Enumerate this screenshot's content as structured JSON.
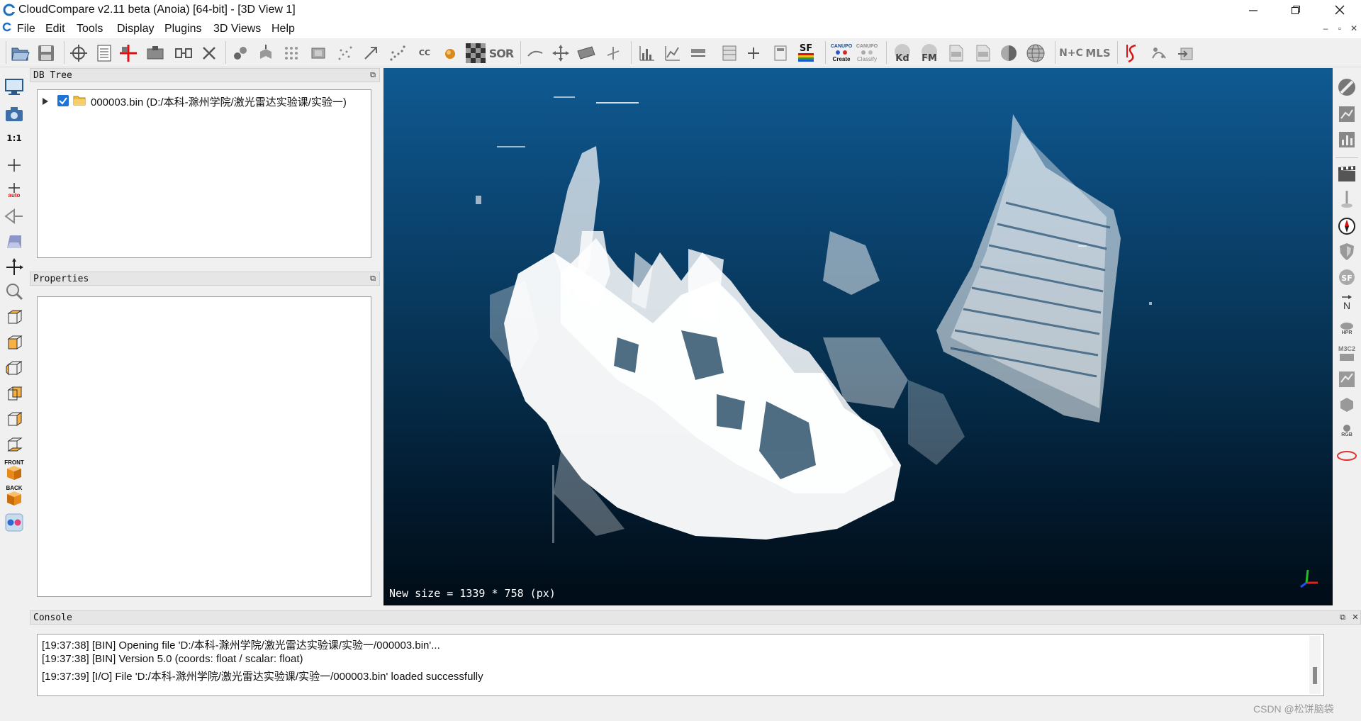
{
  "window": {
    "title": "CloudCompare v2.11 beta (Anoia) [64-bit] - [3D View 1]",
    "minimize_icon": "minimize-icon",
    "restore_icon": "restore-icon",
    "close_icon": "close-icon"
  },
  "menu": {
    "items": [
      "File",
      "Edit",
      "Tools",
      "Display",
      "Plugins",
      "3D Views",
      "Help"
    ]
  },
  "toolbar": {
    "sor_label": "SOR",
    "sf_label": "SF",
    "canupo_create_top": "CANUPO",
    "canupo_create_bottom": "Create",
    "canupo_classify_top": "CANUPO",
    "canupo_classify_bottom": "Classify",
    "kd_label": "Kd",
    "fm_label": "FM",
    "nc_label": "N+C",
    "mls_label": "MLS",
    "cc_label": "CC"
  },
  "left_toolbar": {
    "one_to_one_label": "1:1",
    "auto_label": "auto",
    "front_label": "FRONT",
    "back_label": "BACK"
  },
  "right_toolbar": {
    "n_label": "N",
    "hpr_label": "HPR",
    "m3c2_label": "M3C2",
    "rgb_label": "RGB"
  },
  "db_tree": {
    "title": "DB Tree",
    "item_label": "000003.bin (D:/本科-滁州学院/激光雷达实验课/实验一)",
    "item_checked": true
  },
  "properties": {
    "title": "Properties"
  },
  "view3d": {
    "status_text": "New size = 1339 * 758 (px)",
    "background_top": "#0f5a92",
    "background_bottom": "#010c16",
    "point_color": "#ffffff"
  },
  "console": {
    "title": "Console",
    "lines": [
      "[19:37:38] [BIN] Opening file 'D:/本科-滁州学院/激光雷达实验课/实验一/000003.bin'...",
      "[19:37:38] [BIN] Version 5.0 (coords: float / scalar: float)",
      "[19:37:39] [I/O] File 'D:/本科-滁州学院/激光雷达实验课/实验一/000003.bin' loaded successfully"
    ]
  },
  "watermark": "CSDN @松饼脑袋"
}
